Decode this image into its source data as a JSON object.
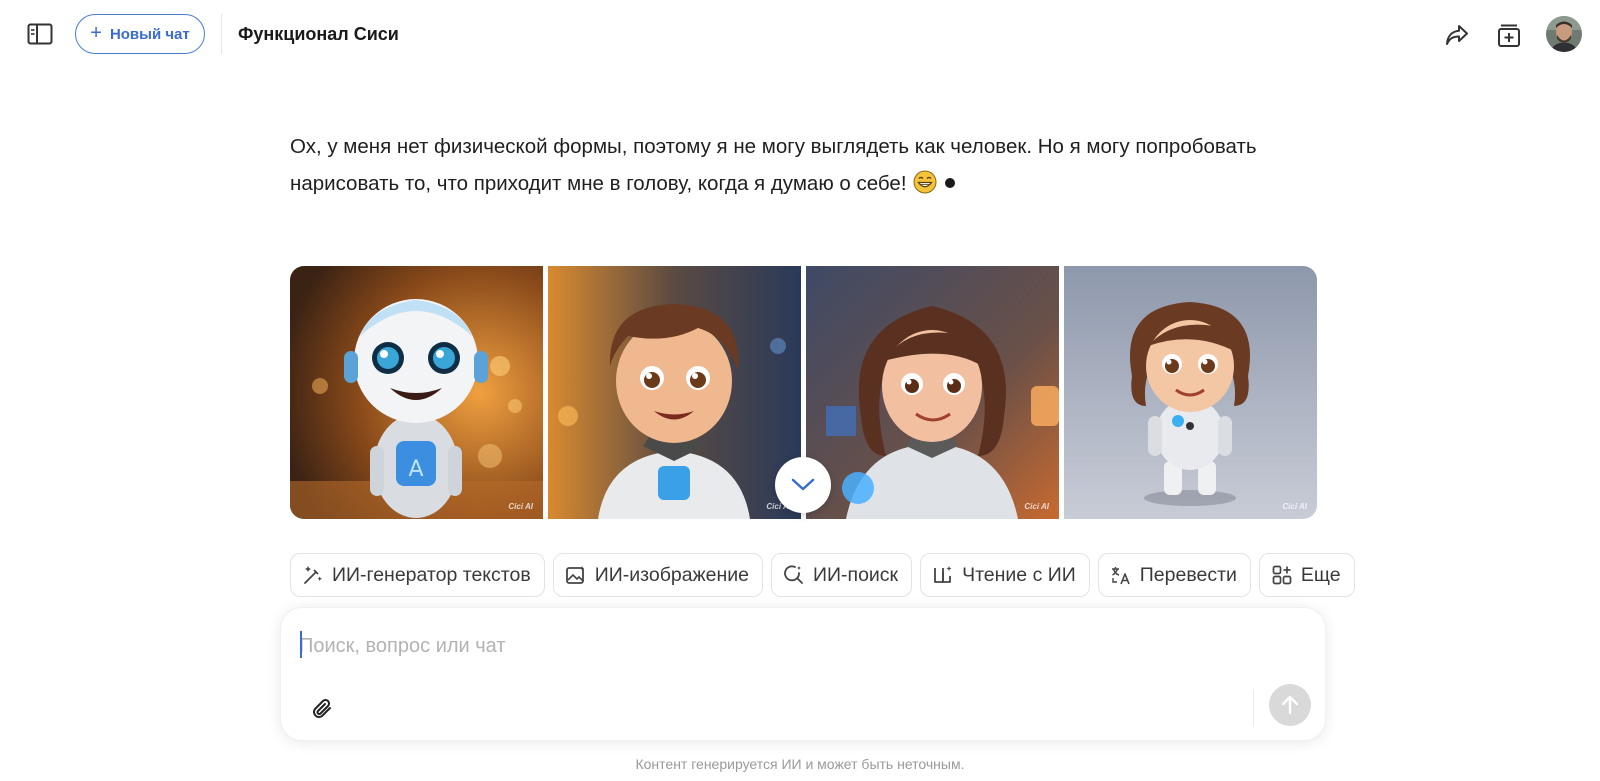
{
  "header": {
    "new_chat_label": "Новый чат",
    "chat_title": "Функционал Сиси"
  },
  "message": {
    "text": "Ох, у меня нет физической формы, поэтому я не могу выглядеть как человек. Но я могу попробовать нарисовать то, что приходит мне в голову, когда я думаю о себе!"
  },
  "gallery": {
    "images": [
      {
        "icon": "robot-mascot-image",
        "watermark": "Cici AI"
      },
      {
        "icon": "boy-robot-image",
        "watermark": "Cici AI"
      },
      {
        "icon": "girl-robot-image",
        "watermark": "Cici AI"
      },
      {
        "icon": "small-girl-robot-image",
        "watermark": "Cici AI"
      }
    ]
  },
  "tools": [
    {
      "label": "ИИ-генератор текстов",
      "icon": "magic-pen-icon"
    },
    {
      "label": "ИИ-изображение",
      "icon": "image-icon"
    },
    {
      "label": "ИИ-поиск",
      "icon": "search-sparkle-icon"
    },
    {
      "label": "Чтение с ИИ",
      "icon": "book-sparkle-icon"
    },
    {
      "label": "Перевести",
      "icon": "translate-icon"
    },
    {
      "label": "Еще",
      "icon": "grid-plus-icon"
    }
  ],
  "composer": {
    "placeholder": "Поиск, вопрос или чат"
  },
  "footer": {
    "disclaimer": "Контент генерируется ИИ и может быть неточным."
  },
  "colors": {
    "accent": "#3a6ccf",
    "send_disabled": "#d9d9d9"
  }
}
